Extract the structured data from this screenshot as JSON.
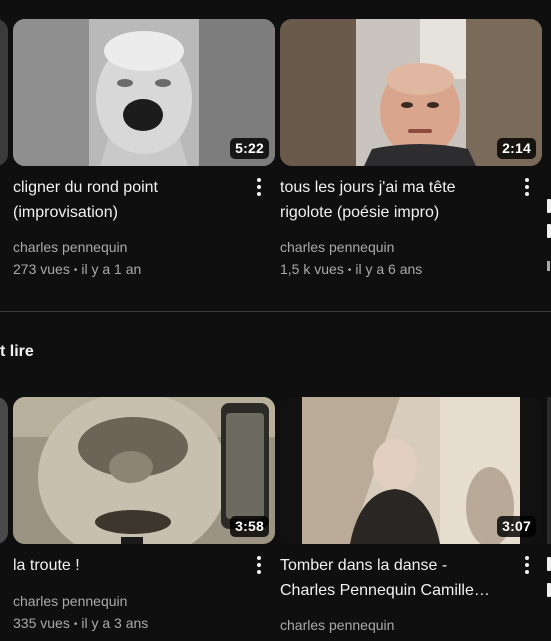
{
  "section": {
    "title": "t lire"
  },
  "videos_top": [
    {
      "title_line1": "cligner du rond point",
      "title_line2": "(improvisation)",
      "channel": "charles pennequin",
      "views": "273 vues",
      "age": "il y a 1 an",
      "duration": "5:22"
    },
    {
      "title_line1": "tous les jours j'ai ma tête",
      "title_line2": "rigolote (poésie impro)",
      "channel": "charles pennequin",
      "views": "1,5 k vues",
      "age": "il y a 6 ans",
      "duration": "2:14"
    }
  ],
  "videos_bottom": [
    {
      "title_line1": "la troute !",
      "channel": "charles pennequin",
      "views": "335 vues",
      "age": "il y a 3 ans",
      "duration": "3:58"
    },
    {
      "title_line1": "Tomber dans la danse -",
      "title_line2": "Charles Pennequin Camille…",
      "channel": "charles pennequin",
      "duration": "3:07"
    }
  ],
  "separator": "•",
  "colors": {
    "background": "#0f0f0f",
    "text": "#f1f1f1",
    "meta": "#aaaaaa"
  }
}
